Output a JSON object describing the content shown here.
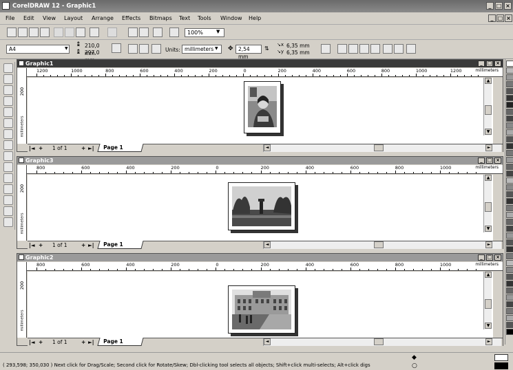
{
  "app": {
    "title": "CorelDRAW 12 - Graphic1"
  },
  "menu": [
    "File",
    "Edit",
    "View",
    "Layout",
    "Arrange",
    "Effects",
    "Bitmaps",
    "Text",
    "Tools",
    "Window",
    "Help"
  ],
  "toolbar": {
    "zoom": "100%"
  },
  "properties": {
    "paper": "A4",
    "width": "210,0 mm",
    "height": "297,0 mm",
    "units_label": "Units:",
    "units": "millimeters",
    "nudge": "2,54 mm",
    "dup_x": "6,35 mm",
    "dup_y": "6,35 mm"
  },
  "windows": [
    {
      "title": "Graphic1",
      "ruler_labels": [
        "1200",
        "1000",
        "800",
        "600",
        "400",
        "200",
        "0",
        "200",
        "400",
        "600",
        "800",
        "1000",
        "1200"
      ],
      "vlabel": "200",
      "page_count": "1 of 1",
      "page_tab": "Page 1",
      "unit": "millimeters",
      "active": true
    },
    {
      "title": "Graphic3",
      "ruler_labels": [
        "800",
        "600",
        "400",
        "200",
        "0",
        "200",
        "400",
        "600",
        "800",
        "1000"
      ],
      "vlabel": "200",
      "page_count": "1 of 1",
      "page_tab": "Page 1",
      "unit": "millimeters",
      "active": false
    },
    {
      "title": "Graphic2",
      "ruler_labels": [
        "800",
        "600",
        "400",
        "200",
        "0",
        "200",
        "400",
        "600",
        "800",
        "1000"
      ],
      "vlabel": "200",
      "page_count": "1 of 1",
      "page_tab": "Page 1",
      "unit": "millimeters",
      "active": false
    }
  ],
  "status": {
    "text": "( 293,598; 350,030 )    Next click for Drag/Scale; Second click for Rotate/Skew; Dbl-clicking tool selects all objects; Shift+click multi-selects; Alt+click digs"
  },
  "colors": {
    "title_active": "#3a3a3a",
    "title_inactive": "#9a9a9a",
    "window_bg": "#d4d0c8"
  },
  "icons": [
    "pick-tool-icon",
    "shape-tool-icon",
    "zoom-tool-icon",
    "freehand-tool-icon",
    "smart-fill-icon",
    "rectangle-tool-icon",
    "ellipse-tool-icon",
    "polygon-tool-icon",
    "basic-shapes-icon",
    "text-tool-icon",
    "interactive-blend-icon",
    "eyedropper-icon",
    "outline-tool-icon",
    "fill-tool-icon",
    "interactive-fill-icon"
  ]
}
